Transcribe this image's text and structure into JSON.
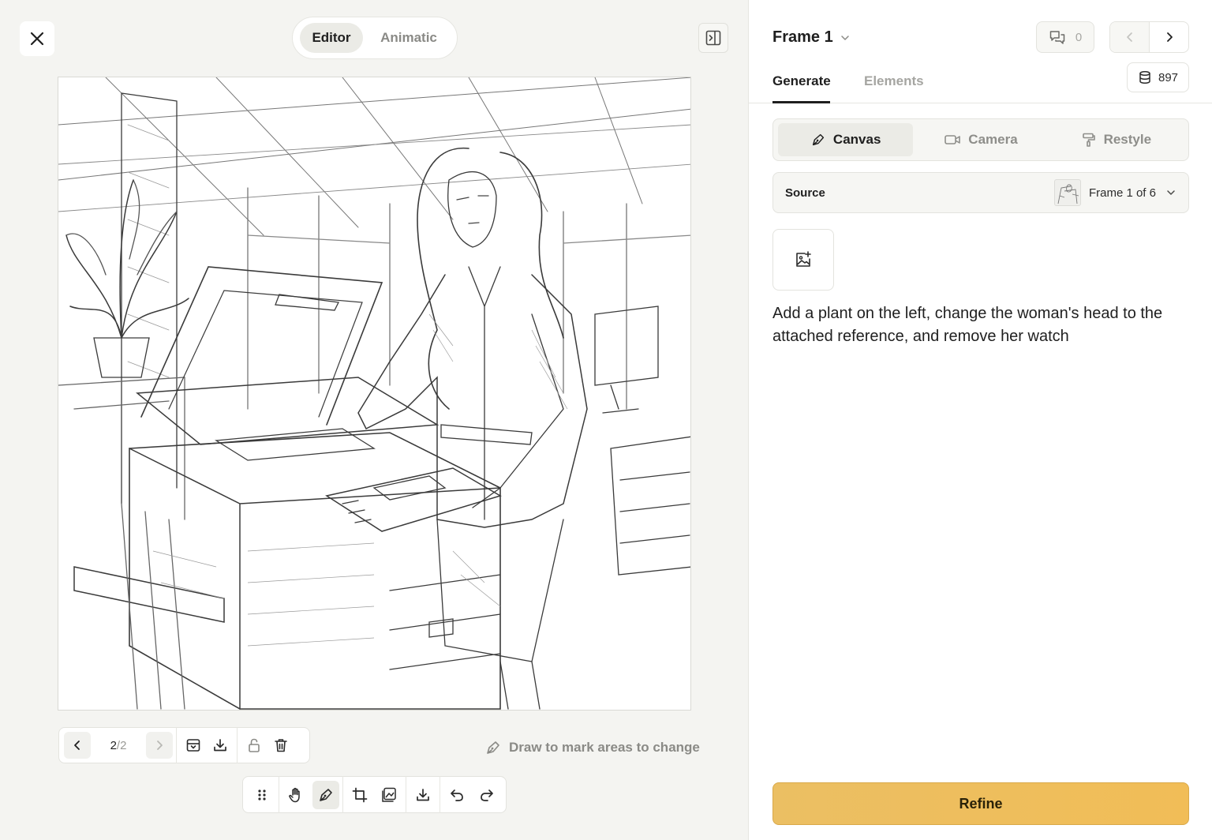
{
  "editor": {
    "modes": [
      "Editor",
      "Animatic"
    ],
    "active_mode": "Editor"
  },
  "version_bar": {
    "current": "2",
    "separator": "/",
    "total": "2"
  },
  "draw_hint": "Draw to mark areas to change",
  "panel": {
    "frame_title": "Frame 1",
    "comment_count": "0",
    "credits": "897",
    "tabs": [
      "Generate",
      "Elements"
    ],
    "active_tab": "Generate",
    "segments": [
      "Canvas",
      "Camera",
      "Restyle"
    ],
    "active_segment": "Canvas",
    "source": {
      "label": "Source",
      "value": "Frame 1 of 6"
    },
    "prompt": "Add a plant on the left, change the woman's head to the attached reference, and remove her watch",
    "refine_label": "Refine"
  },
  "colors": {
    "accent": "#f0bd58",
    "background": "#f4f4f1",
    "panel_bg": "#ffffff",
    "muted_text": "#8a8a86"
  },
  "icons": [
    "close-icon",
    "sidebar-toggle-icon",
    "chevron-left-icon",
    "chevron-right-icon",
    "archive-icon",
    "download-icon",
    "unlock-icon",
    "trash-icon",
    "pen-tool-icon",
    "drag-handle-icon",
    "hand-icon",
    "crop-icon",
    "image-edit-icon",
    "undo-icon",
    "redo-icon",
    "chevron-down-icon",
    "comment-icon",
    "database-icon",
    "video-camera-icon",
    "paint-roller-icon",
    "image-add-icon"
  ]
}
